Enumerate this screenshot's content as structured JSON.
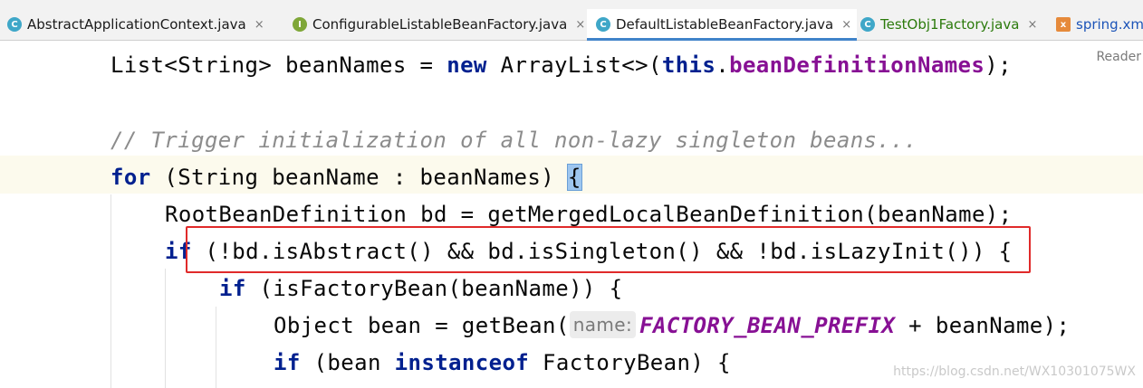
{
  "tabs": [
    {
      "label": "AbstractApplicationContext.java",
      "icon": "class-icon",
      "closable": true
    },
    {
      "label": "ConfigurableListableBeanFactory.java",
      "icon": "interface-icon",
      "closable": true
    },
    {
      "label": "DefaultListableBeanFactory.java",
      "icon": "class-icon",
      "closable": true,
      "active": true
    },
    {
      "label": "TestObj1Factory.java",
      "icon": "class-icon",
      "closable": true
    },
    {
      "label": "spring.xm",
      "icon": "xml-file-icon",
      "closable": false
    }
  ],
  "icon_glyphs": {
    "class": "C",
    "interface": "I",
    "xml": "x",
    "close": "×"
  },
  "reader_mode": "Reader",
  "code": {
    "l1": {
      "a": "List<String> beanNames = ",
      "kw": "new",
      "b": " ArrayList<>(",
      "this": "this",
      "dot": ".",
      "field": "beanDefinitionNames",
      "end": ");"
    },
    "l3": {
      "comment": "// Trigger initialization of all non-lazy singleton beans..."
    },
    "l4": {
      "kw": "for",
      "a": " (String beanName : beanNames) ",
      "brace": "{"
    },
    "l5": {
      "text": "RootBeanDefinition bd = getMergedLocalBeanDefinition(beanName);"
    },
    "l6": {
      "kw": "if",
      "a": " (!bd.isAbstract() && bd.isSingleton() && !bd.isLazyInit()) {"
    },
    "l7": {
      "kw": "if",
      "a": " (isFactoryBean(beanName)) {"
    },
    "l8": {
      "a": "Object bean = getBean(",
      "hint": "name:",
      "const": "FACTORY_BEAN_PREFIX",
      "b": " + beanName);"
    },
    "l9": {
      "kw": "if",
      "a": " (bean ",
      "kw2": "instanceof",
      "b": " FactoryBean) {"
    }
  },
  "colors": {
    "keyword": "#00208f",
    "field": "#871094",
    "comment": "#8c8c8c",
    "highlight_box": "#e02a2a",
    "active_tab_underline": "#4083c9"
  },
  "watermark": "https://blog.csdn.net/WX10301075WX"
}
